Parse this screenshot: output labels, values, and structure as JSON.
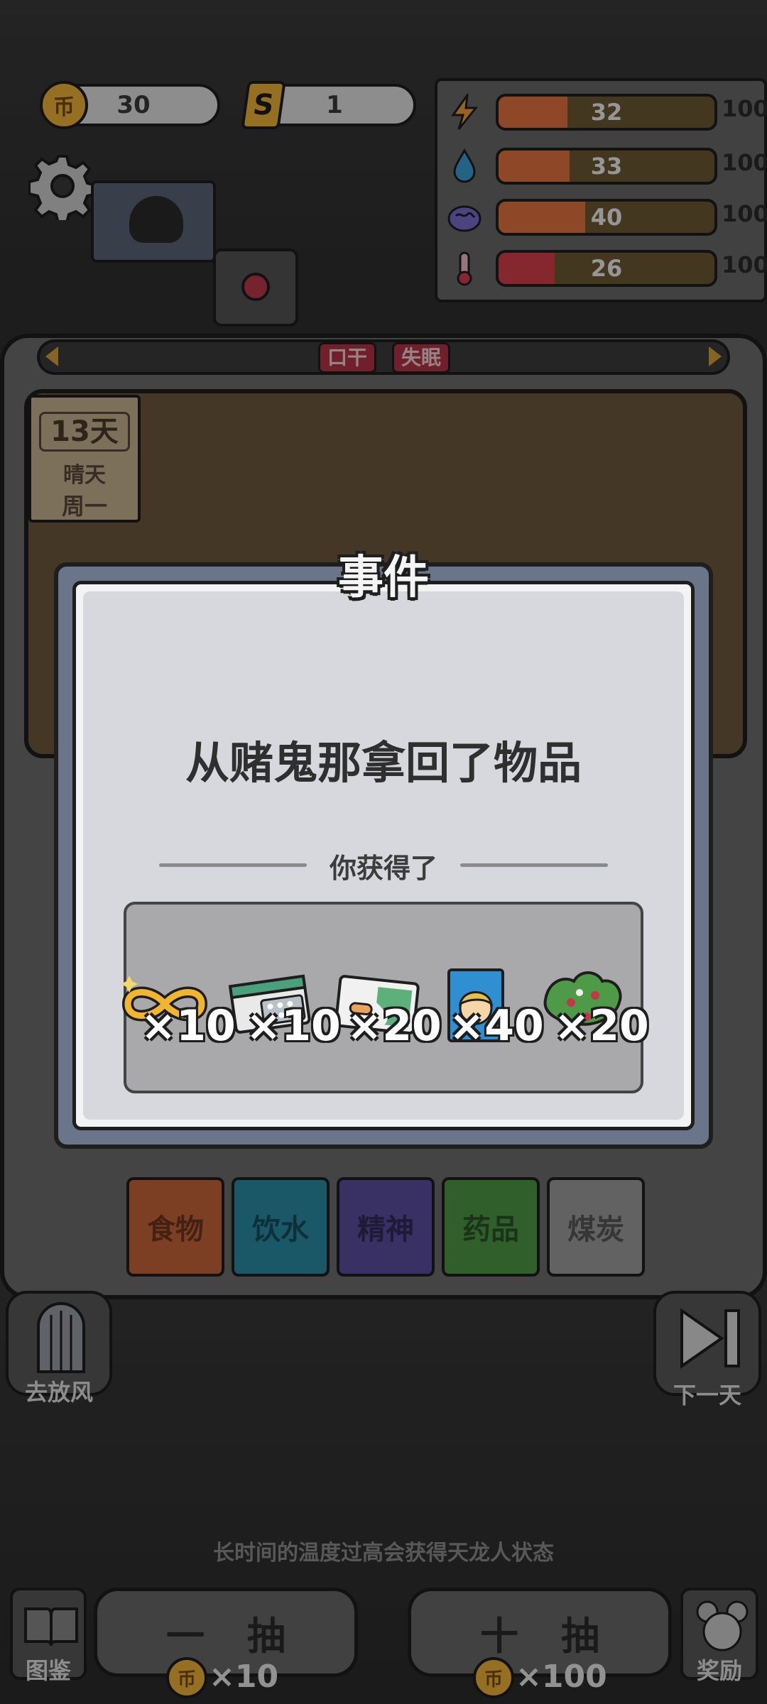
{
  "hud": {
    "coins": "30",
    "currency_s": "1",
    "currency_s_icon": "S",
    "coin_icon": "币"
  },
  "stats": [
    {
      "icon": "lightning-icon",
      "value": "32",
      "max": "100",
      "level": 0.32,
      "color": "#e5743f"
    },
    {
      "icon": "water-drop-icon",
      "value": "33",
      "max": "100",
      "level": 0.33,
      "color": "#e5743f"
    },
    {
      "icon": "brain-icon",
      "value": "40",
      "max": "100",
      "level": 0.4,
      "color": "#e5743f"
    },
    {
      "icon": "thermometer-icon",
      "value": "26",
      "max": "100",
      "level": 0.26,
      "color": "#d9404e"
    }
  ],
  "status_tags": [
    "口干",
    "失眠"
  ],
  "calendar": {
    "day": "13天",
    "weather": "晴天",
    "weekday": "周一"
  },
  "dialog": {
    "title": "事件",
    "message": "从赌鬼那拿回了物品",
    "gain_label": "你获得了",
    "rewards": [
      {
        "icon": "golden-infinity-icon",
        "qty": "×10"
      },
      {
        "icon": "headache-pills-icon",
        "qty": "×10"
      },
      {
        "icon": "ibuprofen-box-icon",
        "qty": "×20"
      },
      {
        "icon": "comic-book-icon",
        "qty": "×40"
      },
      {
        "icon": "salad-icon",
        "qty": "×20"
      }
    ]
  },
  "categories": [
    {
      "label": "食物",
      "color": "#c8663a"
    },
    {
      "label": "饮水",
      "color": "#2a8fa6"
    },
    {
      "label": "精神",
      "color": "#5c4fa0"
    },
    {
      "label": "药品",
      "color": "#4f9a46"
    },
    {
      "label": "煤炭",
      "color": "#9e9e9e"
    }
  ],
  "actions": {
    "go_out": "去放风",
    "next_day": "下一天",
    "catalog": "图鉴",
    "reward": "奖励",
    "draw_one": "一抽",
    "draw_ten": "十抽",
    "draw_one_cost": "×10",
    "draw_ten_cost": "×100"
  },
  "tip": "长时间的温度过高会获得天龙人状态"
}
